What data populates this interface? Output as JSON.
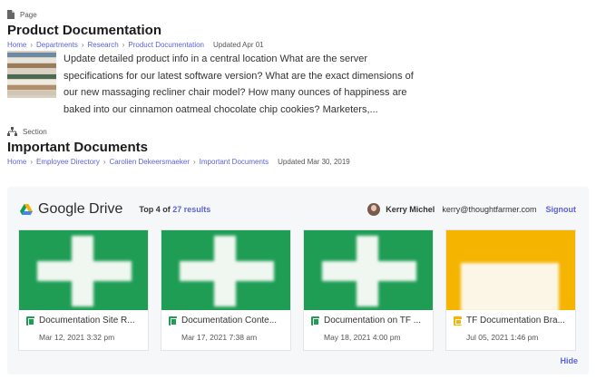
{
  "page_result": {
    "type_label": "Page",
    "title": "Product Documentation",
    "breadcrumbs": [
      "Home",
      "Departments",
      "Research",
      "Product Documentation"
    ],
    "updated": "Updated Apr 01",
    "excerpt": "Update detailed product info in a central location What are the server specifications for our latest software version? What are the exact dimensions of our new massaging recliner chair model? How many ounces of happiness are baked into our cinnamon oatmeal chocolate chip cookies? Marketers,..."
  },
  "section_result": {
    "type_label": "Section",
    "title": "Important Documents",
    "breadcrumbs": [
      "Home",
      "Employee Directory",
      "Carolien Dekeersmaeker",
      "Important Documents"
    ],
    "updated": "Updated Mar 30, 2019"
  },
  "google_drive": {
    "title": "Google Drive",
    "top_prefix": "Top 4 of",
    "results_link": "27 results",
    "user_name": "Kerry Michel",
    "user_email": "kerry@thoughtfarmer.com",
    "signout": "Signout",
    "hide": "Hide",
    "files": [
      {
        "name": "Documentation Site R...",
        "date": "Mar 12, 2021 3:32 pm",
        "kind": "sheet"
      },
      {
        "name": "Documentation Conte...",
        "date": "Mar 17, 2021 7:38 am",
        "kind": "sheet"
      },
      {
        "name": "Documentation on TF ...",
        "date": "May 18, 2021 4:00 pm",
        "kind": "sheet"
      },
      {
        "name": "TF Documentation Bra...",
        "date": "Jul 05, 2021 1:46 pm",
        "kind": "slides"
      }
    ]
  },
  "colors": {
    "link": "#5a63d8",
    "sheet_green": "#1f9d55",
    "slides_yellow": "#f4b400"
  }
}
